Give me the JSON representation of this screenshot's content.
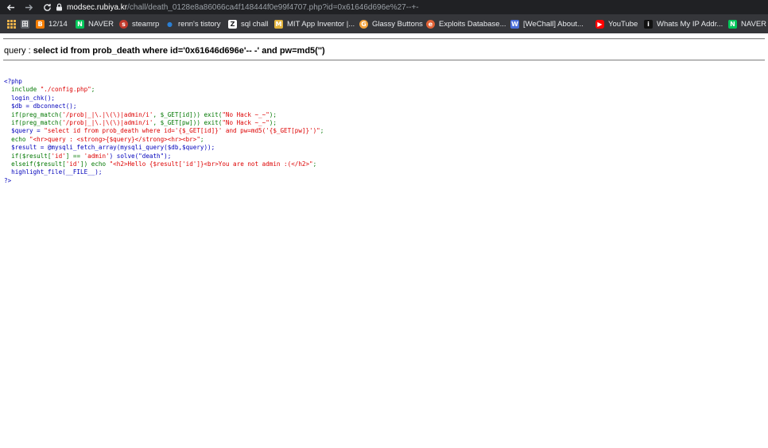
{
  "browser": {
    "url_host": "modsec.rubiya.kr",
    "url_path": "/chall/death_0128e8a86066ca4f148444f0e99f4707.php?id=0x61646d696e%27--+-"
  },
  "bookmarks": [
    {
      "label": "",
      "icon": "apps-icon"
    },
    {
      "label": "",
      "icon": "bookmark-app-icon"
    },
    {
      "label": "12/14",
      "icon": "blogger-icon",
      "color": "#f57d00"
    },
    {
      "label": "NAVER",
      "icon": "naver-icon",
      "color": "#03c75a"
    },
    {
      "label": "steamrp",
      "icon": "steamrp-icon",
      "color": "#c0392b"
    },
    {
      "label": "renn's tistory",
      "icon": "tistory-icon",
      "color": "#2a7fd4"
    },
    {
      "label": "sql chall",
      "icon": "z-icon",
      "color": "#202124"
    },
    {
      "label": "MIT App Inventor |...",
      "icon": "mit-icon",
      "color": "#e2b33c"
    },
    {
      "label": "Glassy Buttons",
      "icon": "glassy-icon",
      "color": "#f2a23a"
    },
    {
      "label": "Exploits Database...",
      "icon": "exploitdb-icon",
      "color": "#e06236"
    },
    {
      "label": "[WeChall] About...",
      "icon": "wechall-icon",
      "color": "#4a6dd8"
    },
    {
      "label": "YouTube",
      "icon": "youtube-icon",
      "color": "#ff0000"
    },
    {
      "label": "Whats My IP Addr...",
      "icon": "ip-icon",
      "color": "#111111"
    },
    {
      "label": "NAVER",
      "icon": "naver-icon",
      "color": "#03c75a"
    }
  ],
  "page": {
    "query_prefix": "query : ",
    "query_value": "select id from prob_death where id='0x61646d696e'-- -' and pw=md5('')",
    "code": {
      "open": "<?php",
      "line_include_kw": "  include ",
      "line_include_str": "\"./config.php\"",
      "line_include_end": ";",
      "line_login": "  login_chk();",
      "line_db": "  $db = dbconnect();",
      "line_preg1_kw": "  if(preg_match(",
      "line_preg1_str": "'/prob|_|\\.|\\(\\)|admin/i'",
      "line_preg1_mid": ", $_GET[id])) exit(",
      "line_preg1_str2": "\"No Hack ~_~\"",
      "line_preg1_end": ");",
      "line_preg2_kw": "  if(preg_match(",
      "line_preg2_str": "'/prob|_|\\.|\\(\\)|admin/i'",
      "line_preg2_mid": ", $_GET[pw])) exit(",
      "line_preg2_str2": "\"No Hack ~_~\"",
      "line_preg2_end": ");",
      "line_query_var": "  $query = ",
      "line_query_str": "\"select id from prob_death where id='{$_GET[id]}' and pw=md5('{$_GET[pw]}')\"",
      "line_query_end": ";",
      "line_echo_kw": "  echo ",
      "line_echo_str": "\"<hr>query : <strong>{$query}</strong><hr><br>\"",
      "line_echo_end": ";",
      "line_result": "  $result = @mysqli_fetch_array(mysqli_query($db,$query));",
      "line_if_kw": "  if($result[",
      "line_if_str": "'id'",
      "line_if_mid": "] == ",
      "line_if_str2": "'admin'",
      "line_if_end": ") solve(\"death\");",
      "line_elseif_kw": "  elseif($result[",
      "line_elseif_str": "'id'",
      "line_elseif_mid": "]) echo ",
      "line_elseif_str2": "\"<h2>Hello {$result['id']}<br>You are not admin :(</h2>\"",
      "line_elseif_end": ";",
      "line_highlight": "  highlight_file(__FILE__);",
      "close": "?>"
    }
  }
}
